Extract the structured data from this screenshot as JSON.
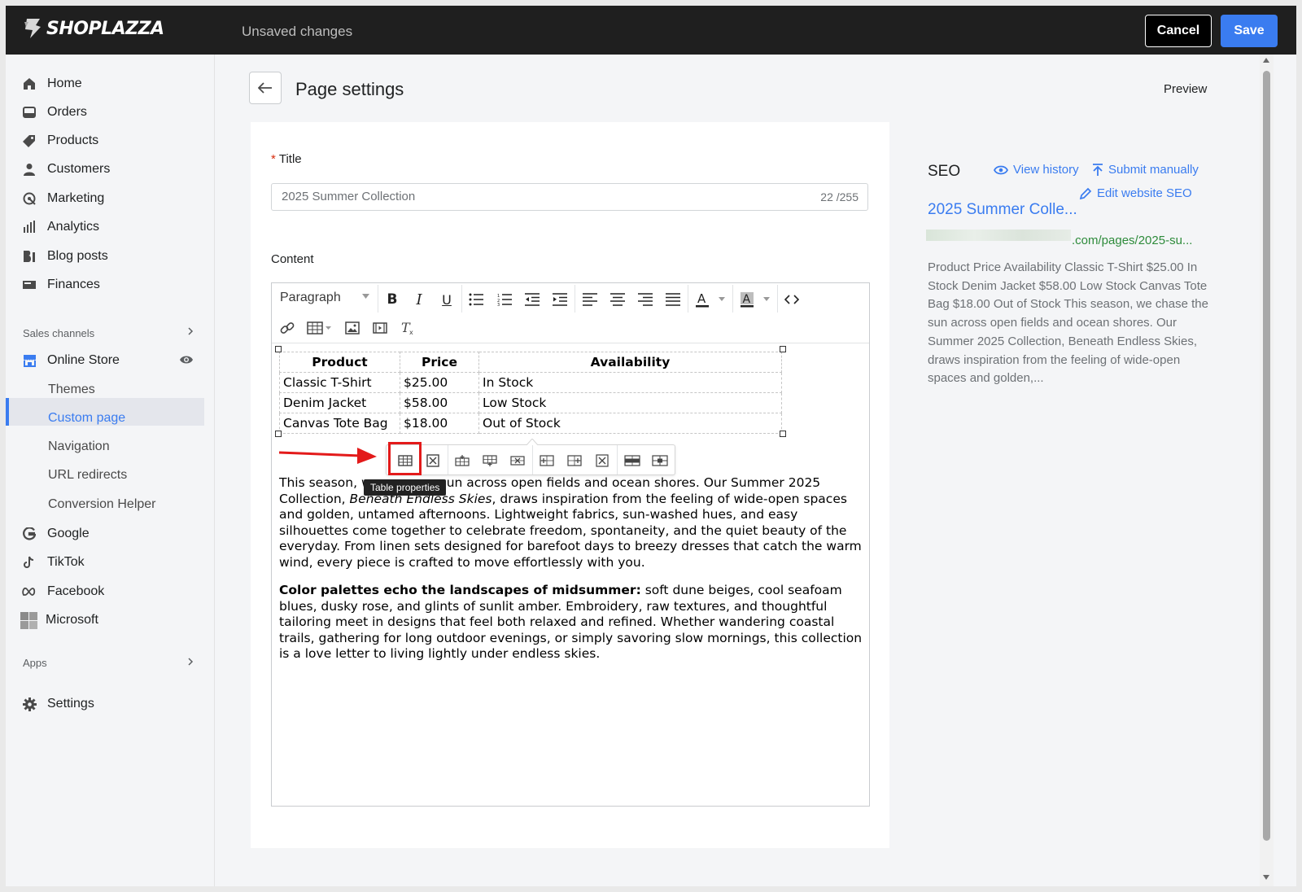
{
  "topbar": {
    "logo_text": "SHOPLAZZA",
    "status": "Unsaved changes",
    "cancel_label": "Cancel",
    "save_label": "Save"
  },
  "sidebar": {
    "items": [
      {
        "label": "Home",
        "icon": "home-icon"
      },
      {
        "label": "Orders",
        "icon": "orders-icon"
      },
      {
        "label": "Products",
        "icon": "tag-icon"
      },
      {
        "label": "Customers",
        "icon": "person-icon"
      },
      {
        "label": "Marketing",
        "icon": "marketing-icon"
      },
      {
        "label": "Analytics",
        "icon": "bar-chart-icon"
      },
      {
        "label": "Blog posts",
        "icon": "blog-icon"
      },
      {
        "label": "Finances",
        "icon": "finance-icon"
      }
    ],
    "sales_channels_label": "Sales channels",
    "online_store_label": "Online Store",
    "online_store_sub": [
      "Themes",
      "Custom page",
      "Navigation",
      "URL redirects",
      "Conversion Helper"
    ],
    "channels": [
      {
        "label": "Google",
        "icon": "google-icon"
      },
      {
        "label": "TikTok",
        "icon": "tiktok-icon"
      },
      {
        "label": "Facebook",
        "icon": "meta-icon"
      },
      {
        "label": "Microsoft",
        "icon": "microsoft-icon"
      }
    ],
    "apps_label": "Apps",
    "settings_label": "Settings"
  },
  "header": {
    "title": "Page settings",
    "preview_label": "Preview"
  },
  "form": {
    "title_label": "Title",
    "title_value": "2025 Summer Collection",
    "title_counter": "22 /255",
    "content_label": "Content"
  },
  "editor": {
    "block_format": "Paragraph",
    "table": {
      "headers": [
        "Product",
        "Price",
        "Availability"
      ],
      "rows": [
        [
          "Classic T-Shirt",
          "$25.00",
          "In Stock"
        ],
        [
          "Denim Jacket",
          "$58.00",
          "Low Stock"
        ],
        [
          "Canvas Tote Bag",
          "$18.00",
          "Out of Stock"
        ]
      ]
    },
    "tooltip": "Table properties",
    "para1_a": "This season, w",
    "para1_b": "sun across open fields and ocean shores. Our Summer 2025 Collection, ",
    "para1_italic": "Beneath Endless Skies",
    "para1_c": ", draws inspiration from the feeling of wide-open spaces and golden, untamed afternoons. Lightweight fabrics, sun-washed hues, and easy silhouettes come together to celebrate freedom, spontaneity, and the quiet beauty of the everyday. From linen sets designed for barefoot days to breezy dresses that catch the warm wind, every piece is crafted to move effortlessly with you.",
    "para2_bold": "Color palettes echo the landscapes of midsummer:",
    "para2_rest": " soft dune beiges, cool seafoam blues, dusky rose, and glints of sunlit amber. Embroidery, raw textures, and thoughtful tailoring meet in designs that feel both relaxed and refined. Whether wandering coastal trails, gathering for long outdoor evenings, or simply savoring slow mornings, this collection is a love letter to living lightly under endless skies."
  },
  "seo": {
    "heading": "SEO",
    "view_history": "View history",
    "submit_manually": "Submit manually",
    "edit_seo": "Edit website SEO",
    "page_title": "2025 Summer Colle...",
    "url": ".com/pages/2025-su...",
    "description": "Product Price Availability Classic T-Shirt $25.00 In Stock Denim Jacket $58.00 Low Stock Canvas Tote Bag $18.00 Out of Stock This season, we chase the sun across open fields and ocean shores. Our Summer 2025 Collection, Beneath Endless Skies, draws inspiration from the feeling of wide-open spaces and golden,..."
  },
  "colors": {
    "accent": "#3a7cf0",
    "topbar": "#1f1f1f",
    "highlight": "#e31a1a",
    "url_green": "#2e8b3b"
  }
}
